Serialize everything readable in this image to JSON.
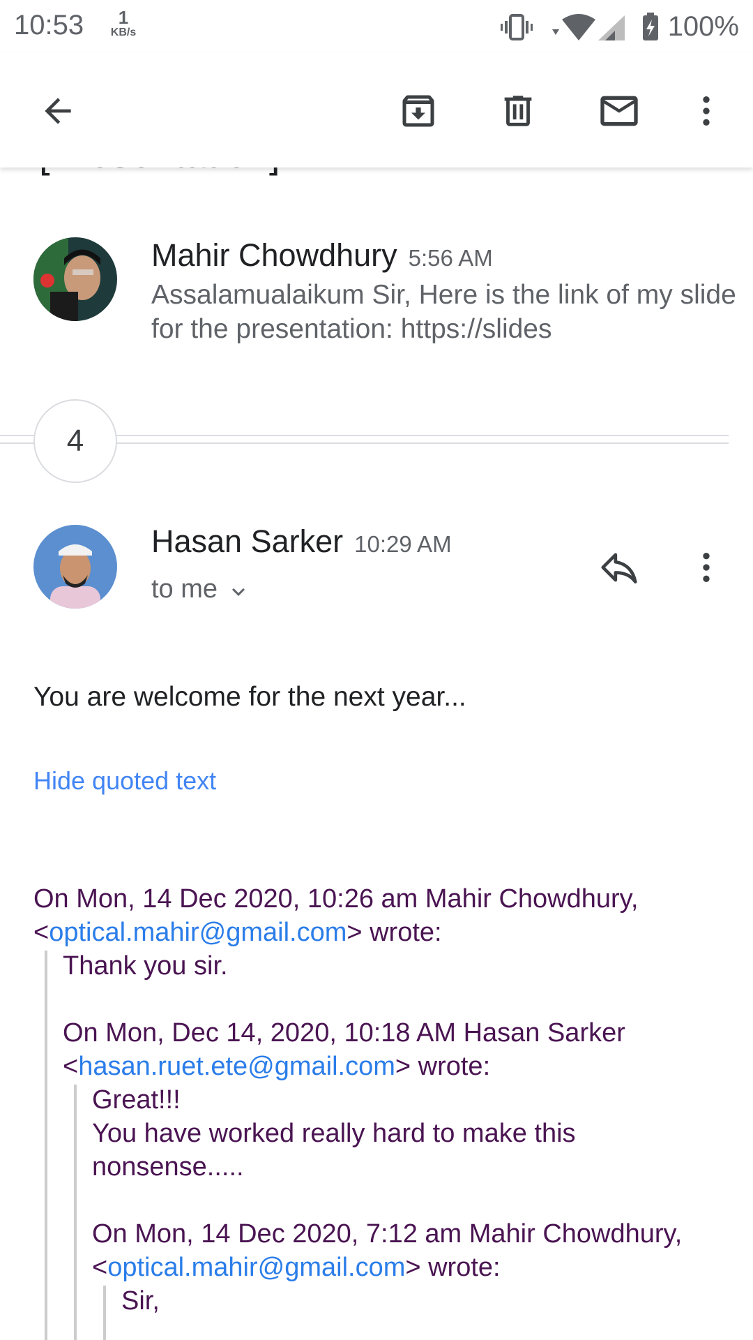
{
  "status_bar": {
    "time": "10:53",
    "net_speed_value": "1",
    "net_speed_unit": "KB/s",
    "battery": "100%",
    "icons": [
      "vibrate-icon",
      "wifi-icon",
      "cell-signal-icon",
      "battery-charging-icon"
    ]
  },
  "toolbar": {
    "icons": [
      "back-arrow-icon",
      "archive-icon",
      "delete-icon",
      "mark-unread-icon",
      "more-vert-icon"
    ]
  },
  "thread": {
    "subject_partial": "[Presentation]",
    "messages": [
      {
        "sender": "Mahir Chowdhury",
        "time": "5:56 AM",
        "snippet": "Assalamualaikum Sir, Here is the link of my slide for the presentation: https://slides"
      }
    ],
    "collapsed_count": "4",
    "expanded": {
      "sender": "Hasan Sarker",
      "time": "10:29 AM",
      "recipient": "to me",
      "body": "You are welcome for the next year...",
      "hide_quoted_label": "Hide quoted text",
      "quote1": {
        "header_prefix": "On Mon, 14 Dec 2020, 10:26 am Mahir Chowdhury,",
        "email": "optical.mahir@gmail.com",
        "wrote": "wrote:",
        "text": "Thank you sir."
      },
      "quote2": {
        "header_prefix": "On Mon, Dec 14, 2020, 10:18 AM Hasan Sarker",
        "email": "hasan.ruet.ete@gmail.com",
        "wrote": "wrote:",
        "line1": "Great!!!",
        "line2": "You have worked really hard to make this",
        "line3": "nonsense....."
      },
      "quote3": {
        "header_prefix": "On Mon, 14 Dec 2020, 7:12 am Mahir Chowdhury,",
        "email": "optical.mahir@gmail.com",
        "wrote": "wrote:",
        "text": "Sir,"
      }
    }
  },
  "colors": {
    "link": "#2b7de9",
    "quote_text": "#4a1452",
    "action_blue": "#4285f4"
  }
}
